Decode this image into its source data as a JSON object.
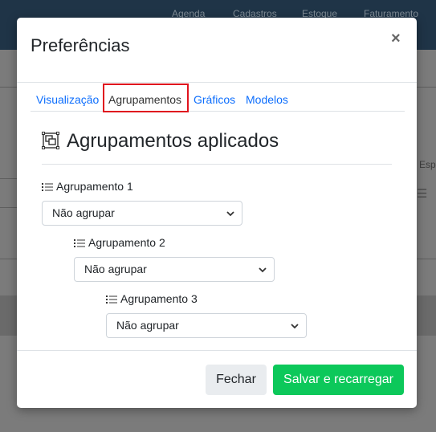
{
  "background": {
    "nav_items": [
      "Agenda",
      "Cadastros",
      "Estoque",
      "Faturamento"
    ],
    "side_text": "Espec"
  },
  "modal": {
    "title": "Preferências",
    "close_symbol": "×",
    "tabs": [
      {
        "label": "Visualização",
        "active": false
      },
      {
        "label": "Agrupamentos",
        "active": true
      },
      {
        "label": "Gráficos",
        "active": false
      },
      {
        "label": "Modelos",
        "active": false
      }
    ],
    "section_title": "Agrupamentos aplicados",
    "section_icon": "group-objects-icon",
    "groups": [
      {
        "label": "Agrupamento 1",
        "selected": "Não agrupar"
      },
      {
        "label": "Agrupamento 2",
        "selected": "Não agrupar"
      },
      {
        "label": "Agrupamento 3",
        "selected": "Não agrupar"
      }
    ],
    "buttons": {
      "close_label": "Fechar",
      "save_label": "Salvar e recarregar"
    }
  },
  "colors": {
    "accent_blue": "#0d6efd",
    "save_green": "#0cc85a",
    "highlight_red": "#e0141e"
  }
}
